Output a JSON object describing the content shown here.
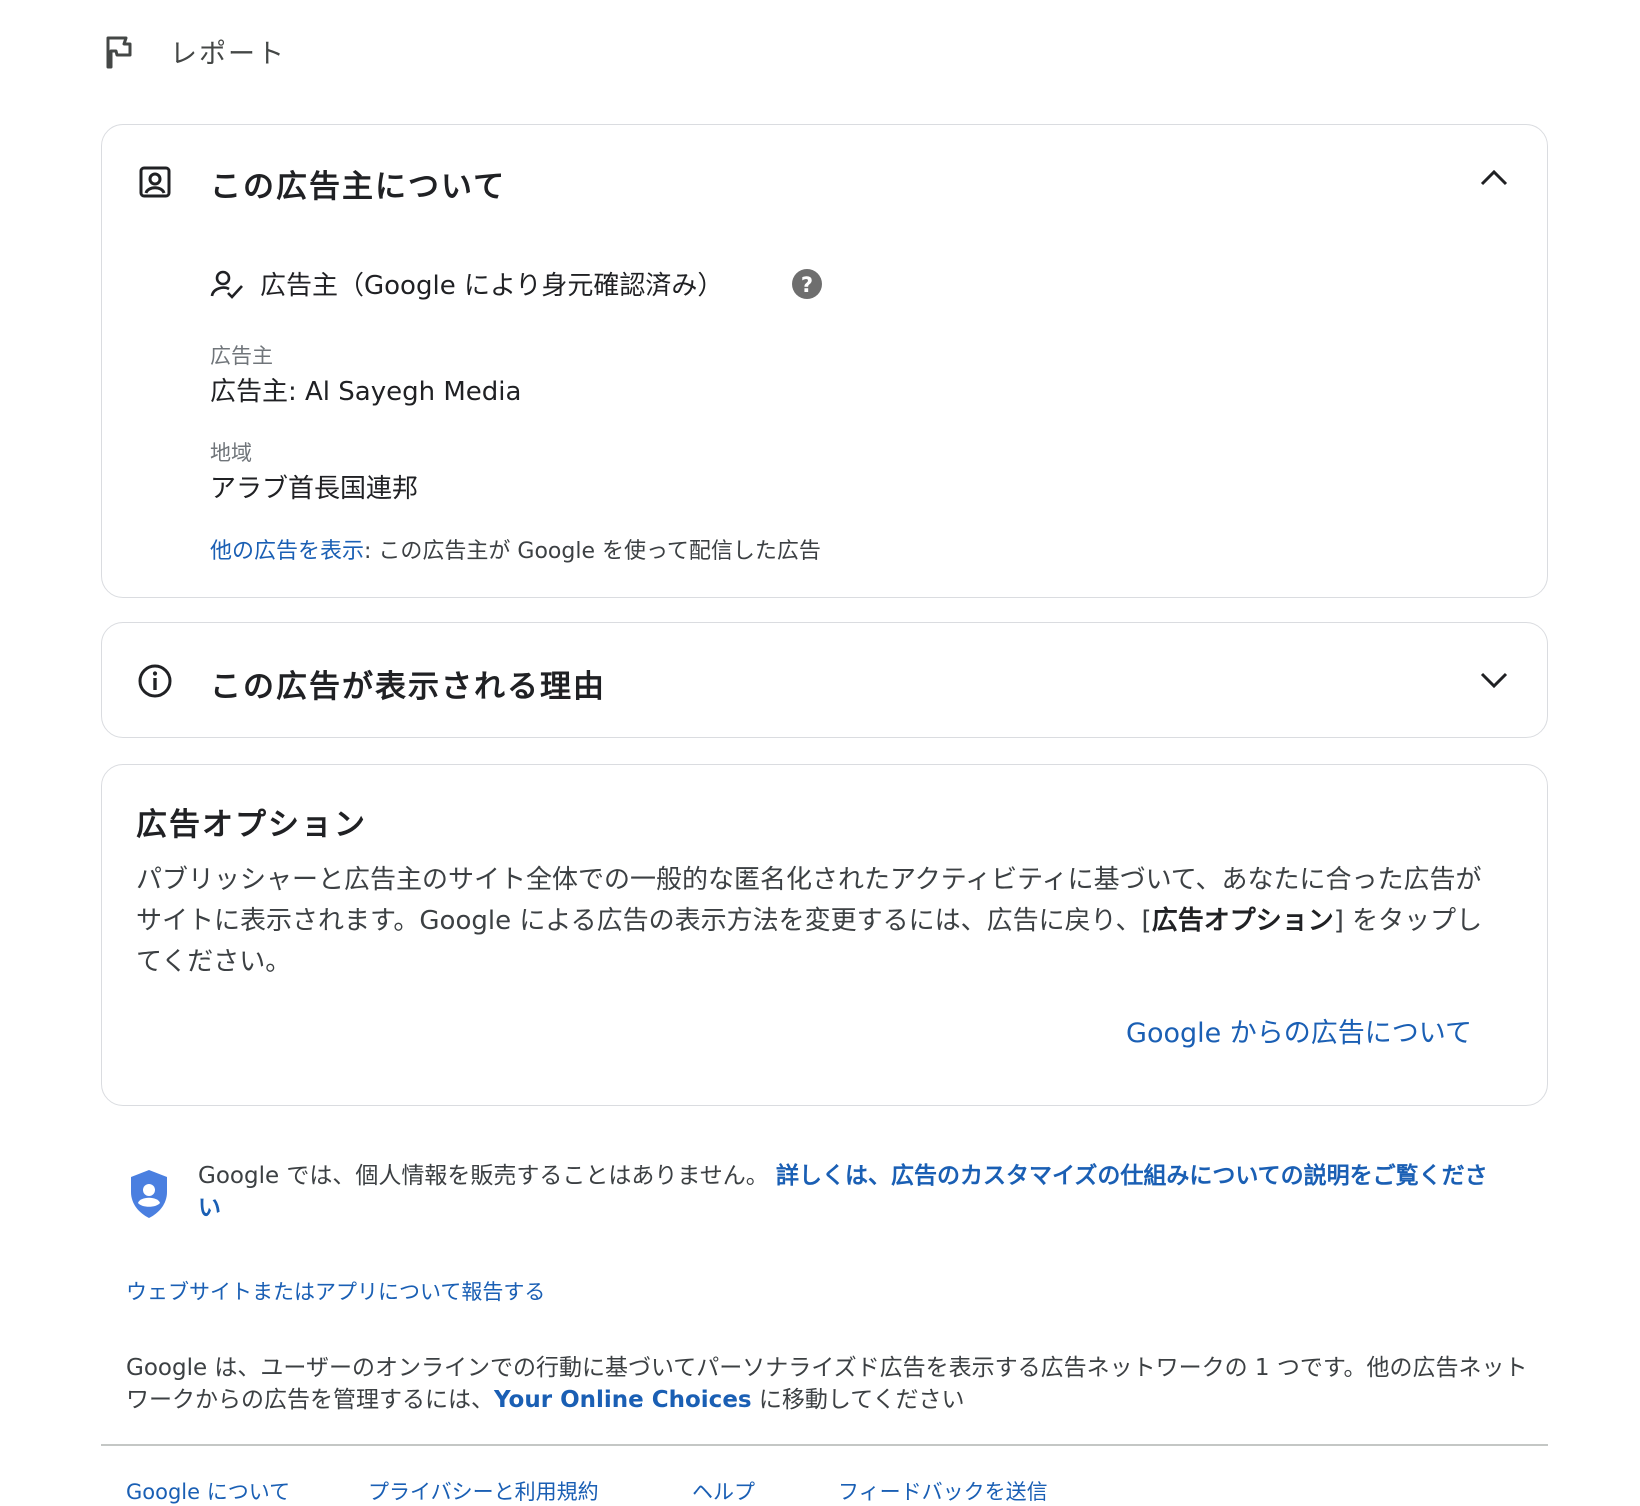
{
  "header": {
    "report_label": "レポート",
    "flag_icon": "flag-icon"
  },
  "advertiser_section": {
    "title": "この広告主について",
    "verified_label": "広告主（Google により身元確認済み）",
    "advertiser_label": "広告主",
    "advertiser_value": "広告主: Al Sayegh Media",
    "region_label": "地域",
    "region_value": "アラブ首長国連邦",
    "more_ads_link": "他の広告を表示",
    "more_ads_suffix": ": この広告主が Google を使って配信した広告"
  },
  "why_section": {
    "title": "この広告が表示される理由"
  },
  "options_section": {
    "title": "広告オプション",
    "body_part1": "パブリッシャーと広告主のサイト全体での一般的な匿名化されたアクティビティに基づいて、あなたに合った広告がサイトに表示されます。Google による広告の表示方法を変更するには、広告に戻り、[",
    "body_bold": "広告オプション",
    "body_part2": "] をタップしてください。",
    "about_link": "Google からの広告について"
  },
  "privacy": {
    "text": "Google では、個人情報を販売することはありません。",
    "link": "詳しくは、広告のカスタマイズの仕組みについての説明をご覧ください"
  },
  "report_site_link": "ウェブサイトまたはアプリについて報告する",
  "network_notice": {
    "text_part1": "Google は、ユーザーのオンラインでの行動に基づいてパーソナライズド広告を表示する広告ネットワークの 1 つです。他の広告ネットワークからの広告を管理するには、",
    "link": "Your Online Choices",
    "text_part2": " に移動してください"
  },
  "footer": {
    "links": [
      "Google について",
      "プライバシーと利用規約",
      "ヘルプ",
      "フィードバックを送信"
    ]
  },
  "colors": {
    "link": "#1a5fb4",
    "border": "#dadce0",
    "shield": "#4a7fe0",
    "help_icon": "#6e6e6e"
  }
}
